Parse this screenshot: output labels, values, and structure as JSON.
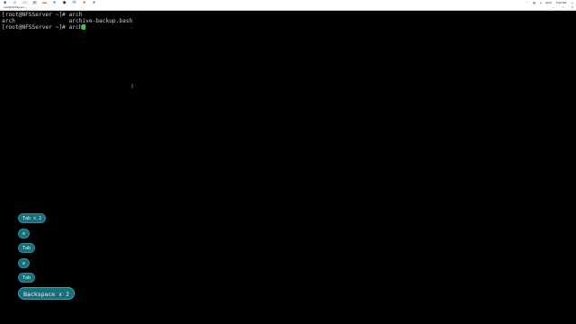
{
  "taskbar": {
    "icons": [
      "windows-start-icon",
      "search-icon",
      "task-view-icon",
      "terminal-app-icon",
      "file-explorer-icon",
      "edge-browser-icon",
      "network-icon",
      "mail-icon",
      "store-icon",
      "app-icon"
    ],
    "tray": {
      "language": "ENG",
      "time": "5:29 PM"
    }
  },
  "window": {
    "title": "root@NFSServer:~",
    "controls": [
      "—",
      "□",
      "✕"
    ]
  },
  "terminal": {
    "lines": [
      "[root@NFSServer ~]# arch",
      "arch                archive-backup.bash",
      "[root@NFSServer ~]# arch"
    ],
    "cursor_color": "#2ecc40"
  },
  "keystrokes": [
    {
      "label": "Tab x 2",
      "big": false
    },
    {
      "label": "e",
      "big": false
    },
    {
      "label": "Tab",
      "big": false
    },
    {
      "label": "e",
      "big": false
    },
    {
      "label": "Tab",
      "big": false
    },
    {
      "label": "Backspace x 2",
      "big": true
    }
  ],
  "colors": {
    "background": "#000000",
    "key_bg": "#16707b",
    "text": "#cfcfcf"
  }
}
